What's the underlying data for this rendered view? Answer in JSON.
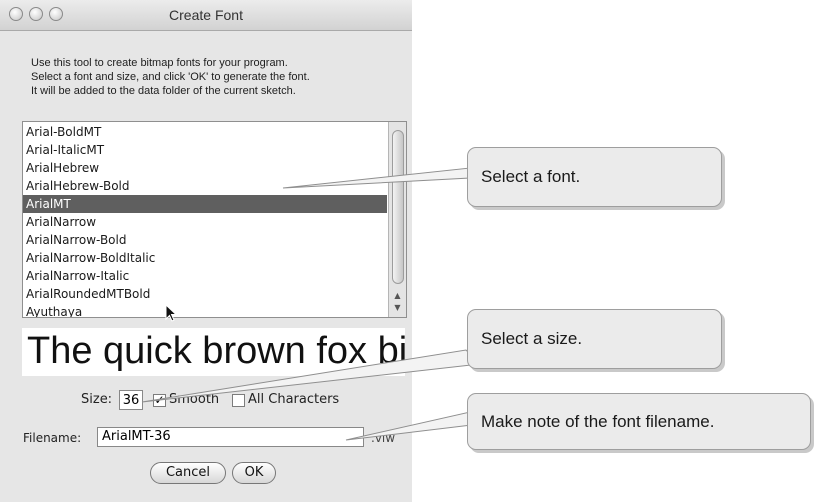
{
  "window": {
    "title": "Create Font"
  },
  "description": {
    "lines": [
      "Use this tool to create bitmap fonts for your program.",
      "Select a font and size, and click 'OK' to generate the font.",
      "It will be added to the data folder of the current sketch."
    ]
  },
  "font_list": {
    "items": [
      "Arial-BoldMT",
      "Arial-ItalicMT",
      "ArialHebrew",
      "ArialHebrew-Bold",
      "ArialMT",
      "ArialNarrow",
      "ArialNarrow-Bold",
      "ArialNarrow-BoldItalic",
      "ArialNarrow-Italic",
      "ArialRoundedMTBold",
      "Ayuthaya"
    ],
    "selected_index": 4
  },
  "preview": {
    "text": "The quick brown fox bi"
  },
  "size": {
    "label": "Size:",
    "value": "36"
  },
  "smooth": {
    "label": "Smooth",
    "checked": true
  },
  "all_characters": {
    "label": "All Characters",
    "checked": false
  },
  "filename": {
    "label": "Filename:",
    "value": "ArialMT-36",
    "extension": ".vlw"
  },
  "buttons": {
    "cancel": "Cancel",
    "ok": "OK"
  },
  "callouts": {
    "select_font": "Select a font.",
    "select_size": "Select a size.",
    "filename_note": "Make note of the font filename."
  }
}
